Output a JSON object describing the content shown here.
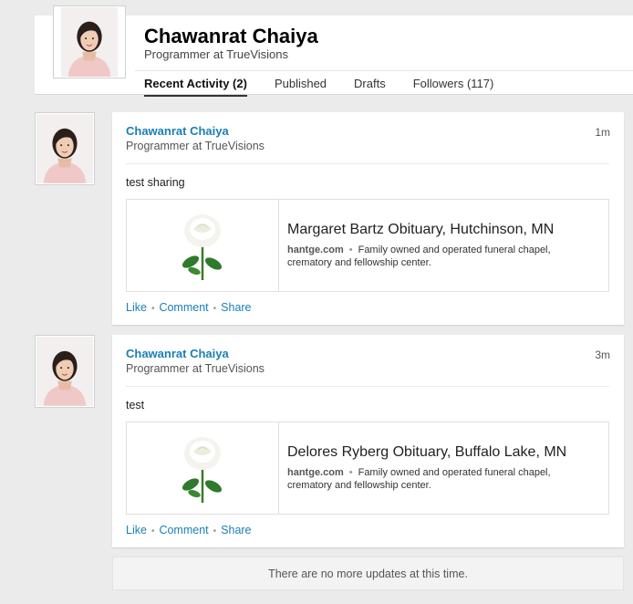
{
  "profile": {
    "name": "Chawanrat Chaiya",
    "headline": "Programmer at TrueVisions"
  },
  "tabs": [
    {
      "label": "Recent Activity (2)",
      "active": true
    },
    {
      "label": "Published",
      "active": false
    },
    {
      "label": "Drafts",
      "active": false
    },
    {
      "label": "Followers (117)",
      "active": false
    }
  ],
  "posts": [
    {
      "author": "Chawanrat Chaiya",
      "headline": "Programmer at TrueVisions",
      "time": "1m",
      "text": "test sharing",
      "link": {
        "title": "Margaret Bartz Obituary, Hutchinson, MN",
        "domain": "hantge.com",
        "description": "Family owned and operated funeral chapel, crematory and fellowship center."
      },
      "actions": {
        "like": "Like",
        "comment": "Comment",
        "share": "Share"
      }
    },
    {
      "author": "Chawanrat Chaiya",
      "headline": "Programmer at TrueVisions",
      "time": "3m",
      "text": "test",
      "link": {
        "title": "Delores Ryberg Obituary, Buffalo Lake, MN",
        "domain": "hantge.com",
        "description": "Family owned and operated funeral chapel, crematory and fellowship center."
      },
      "actions": {
        "like": "Like",
        "comment": "Comment",
        "share": "Share"
      }
    }
  ],
  "footer": {
    "no_more": "There are no more updates at this time."
  },
  "icons": {
    "avatar": "profile-photo",
    "thumbnail": "white-rose-image"
  },
  "colors": {
    "link": "#1a7fb3",
    "background": "#ebebeb"
  }
}
